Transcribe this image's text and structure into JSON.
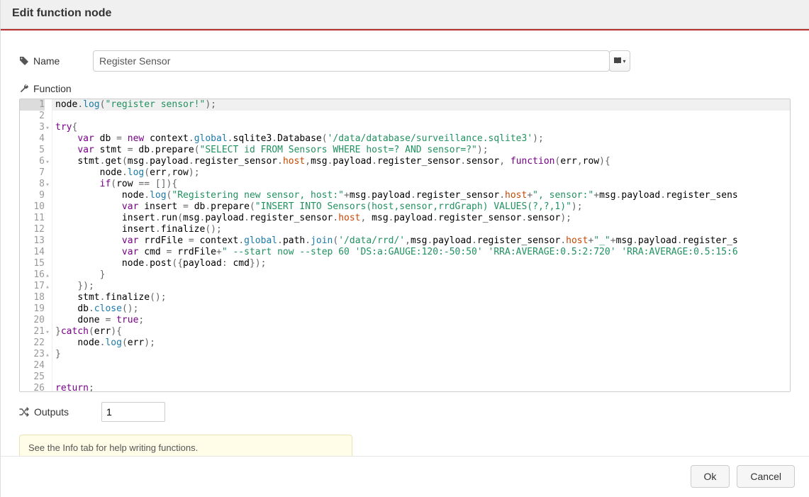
{
  "dialog": {
    "title": "Edit function node",
    "name_label": "Name",
    "name_value": "Register Sensor",
    "function_label": "Function",
    "outputs_label": "Outputs",
    "outputs_value": "1",
    "tip": "See the Info tab for help writing functions.",
    "ok_label": "Ok",
    "cancel_label": "Cancel",
    "book_icon": "book-icon",
    "dropdown_icon": "chevron-down-icon"
  },
  "editor": {
    "gutter": [
      {
        "n": "1",
        "fold": ""
      },
      {
        "n": "2",
        "fold": ""
      },
      {
        "n": "3",
        "fold": "▾"
      },
      {
        "n": "4",
        "fold": ""
      },
      {
        "n": "5",
        "fold": ""
      },
      {
        "n": "6",
        "fold": "▾"
      },
      {
        "n": "7",
        "fold": ""
      },
      {
        "n": "8",
        "fold": "▾"
      },
      {
        "n": "9",
        "fold": ""
      },
      {
        "n": "10",
        "fold": ""
      },
      {
        "n": "11",
        "fold": ""
      },
      {
        "n": "12",
        "fold": ""
      },
      {
        "n": "13",
        "fold": ""
      },
      {
        "n": "14",
        "fold": ""
      },
      {
        "n": "15",
        "fold": ""
      },
      {
        "n": "16",
        "fold": "▴"
      },
      {
        "n": "17",
        "fold": "▴"
      },
      {
        "n": "18",
        "fold": ""
      },
      {
        "n": "19",
        "fold": ""
      },
      {
        "n": "20",
        "fold": ""
      },
      {
        "n": "21",
        "fold": "▾"
      },
      {
        "n": "22",
        "fold": ""
      },
      {
        "n": "23",
        "fold": "▴"
      },
      {
        "n": "24",
        "fold": ""
      },
      {
        "n": "25",
        "fold": ""
      },
      {
        "n": "26",
        "fold": ""
      }
    ],
    "lines": [
      [
        {
          "c": "id",
          "t": "node"
        },
        {
          "c": "op",
          "t": "."
        },
        {
          "c": "glob",
          "t": "log"
        },
        {
          "c": "op",
          "t": "("
        },
        {
          "c": "str",
          "t": "\"register sensor!\""
        },
        {
          "c": "op",
          "t": ");"
        }
      ],
      [],
      [
        {
          "c": "kw",
          "t": "try"
        },
        {
          "c": "op",
          "t": "{"
        }
      ],
      [
        {
          "c": "ws",
          "t": "    "
        },
        {
          "c": "kw",
          "t": "var"
        },
        {
          "c": "ws",
          "t": " "
        },
        {
          "c": "id",
          "t": "db"
        },
        {
          "c": "ws",
          "t": " "
        },
        {
          "c": "op",
          "t": "="
        },
        {
          "c": "ws",
          "t": " "
        },
        {
          "c": "kw",
          "t": "new"
        },
        {
          "c": "ws",
          "t": " "
        },
        {
          "c": "id",
          "t": "context"
        },
        {
          "c": "op",
          "t": "."
        },
        {
          "c": "glob",
          "t": "global"
        },
        {
          "c": "op",
          "t": "."
        },
        {
          "c": "id",
          "t": "sqlite3"
        },
        {
          "c": "op",
          "t": "."
        },
        {
          "c": "id",
          "t": "Database"
        },
        {
          "c": "op",
          "t": "("
        },
        {
          "c": "str",
          "t": "'/data/database/surveillance.sqlite3'"
        },
        {
          "c": "op",
          "t": ");"
        }
      ],
      [
        {
          "c": "ws",
          "t": "    "
        },
        {
          "c": "kw",
          "t": "var"
        },
        {
          "c": "ws",
          "t": " "
        },
        {
          "c": "id",
          "t": "stmt"
        },
        {
          "c": "ws",
          "t": " "
        },
        {
          "c": "op",
          "t": "="
        },
        {
          "c": "ws",
          "t": " "
        },
        {
          "c": "id",
          "t": "db"
        },
        {
          "c": "op",
          "t": "."
        },
        {
          "c": "id",
          "t": "prepare"
        },
        {
          "c": "op",
          "t": "("
        },
        {
          "c": "str",
          "t": "\"SELECT id FROM Sensors WHERE host=? AND sensor=?\""
        },
        {
          "c": "op",
          "t": ");"
        }
      ],
      [
        {
          "c": "ws",
          "t": "    "
        },
        {
          "c": "id",
          "t": "stmt"
        },
        {
          "c": "op",
          "t": "."
        },
        {
          "c": "id",
          "t": "get"
        },
        {
          "c": "op",
          "t": "("
        },
        {
          "c": "id",
          "t": "msg"
        },
        {
          "c": "op",
          "t": "."
        },
        {
          "c": "id",
          "t": "payload"
        },
        {
          "c": "op",
          "t": "."
        },
        {
          "c": "id",
          "t": "register_sensor"
        },
        {
          "c": "op",
          "t": "."
        },
        {
          "c": "prop",
          "t": "host"
        },
        {
          "c": "op",
          "t": ","
        },
        {
          "c": "id",
          "t": "msg"
        },
        {
          "c": "op",
          "t": "."
        },
        {
          "c": "id",
          "t": "payload"
        },
        {
          "c": "op",
          "t": "."
        },
        {
          "c": "id",
          "t": "register_sensor"
        },
        {
          "c": "op",
          "t": "."
        },
        {
          "c": "id",
          "t": "sensor"
        },
        {
          "c": "op",
          "t": ", "
        },
        {
          "c": "kw",
          "t": "function"
        },
        {
          "c": "op",
          "t": "("
        },
        {
          "c": "id",
          "t": "err"
        },
        {
          "c": "op",
          "t": ","
        },
        {
          "c": "id",
          "t": "row"
        },
        {
          "c": "op",
          "t": "){"
        }
      ],
      [
        {
          "c": "ws",
          "t": "        "
        },
        {
          "c": "id",
          "t": "node"
        },
        {
          "c": "op",
          "t": "."
        },
        {
          "c": "glob",
          "t": "log"
        },
        {
          "c": "op",
          "t": "("
        },
        {
          "c": "id",
          "t": "err"
        },
        {
          "c": "op",
          "t": ","
        },
        {
          "c": "id",
          "t": "row"
        },
        {
          "c": "op",
          "t": ");"
        }
      ],
      [
        {
          "c": "ws",
          "t": "        "
        },
        {
          "c": "kw",
          "t": "if"
        },
        {
          "c": "op",
          "t": "("
        },
        {
          "c": "id",
          "t": "row"
        },
        {
          "c": "ws",
          "t": " "
        },
        {
          "c": "op",
          "t": "=="
        },
        {
          "c": "ws",
          "t": " "
        },
        {
          "c": "op",
          "t": "[]){"
        }
      ],
      [
        {
          "c": "ws",
          "t": "            "
        },
        {
          "c": "id",
          "t": "node"
        },
        {
          "c": "op",
          "t": "."
        },
        {
          "c": "glob",
          "t": "log"
        },
        {
          "c": "op",
          "t": "("
        },
        {
          "c": "str",
          "t": "\"Registering new sensor, host:\""
        },
        {
          "c": "op",
          "t": "+"
        },
        {
          "c": "id",
          "t": "msg"
        },
        {
          "c": "op",
          "t": "."
        },
        {
          "c": "id",
          "t": "payload"
        },
        {
          "c": "op",
          "t": "."
        },
        {
          "c": "id",
          "t": "register_sensor"
        },
        {
          "c": "op",
          "t": "."
        },
        {
          "c": "prop",
          "t": "host"
        },
        {
          "c": "op",
          "t": "+"
        },
        {
          "c": "str",
          "t": "\", sensor:\""
        },
        {
          "c": "op",
          "t": "+"
        },
        {
          "c": "id",
          "t": "msg"
        },
        {
          "c": "op",
          "t": "."
        },
        {
          "c": "id",
          "t": "payload"
        },
        {
          "c": "op",
          "t": "."
        },
        {
          "c": "id",
          "t": "register_sens"
        }
      ],
      [
        {
          "c": "ws",
          "t": "            "
        },
        {
          "c": "kw",
          "t": "var"
        },
        {
          "c": "ws",
          "t": " "
        },
        {
          "c": "id",
          "t": "insert"
        },
        {
          "c": "ws",
          "t": " "
        },
        {
          "c": "op",
          "t": "="
        },
        {
          "c": "ws",
          "t": " "
        },
        {
          "c": "id",
          "t": "db"
        },
        {
          "c": "op",
          "t": "."
        },
        {
          "c": "id",
          "t": "prepare"
        },
        {
          "c": "op",
          "t": "("
        },
        {
          "c": "str",
          "t": "\"INSERT INTO Sensors(host,sensor,rrdGraph) VALUES(?,?,1)\""
        },
        {
          "c": "op",
          "t": ");"
        }
      ],
      [
        {
          "c": "ws",
          "t": "            "
        },
        {
          "c": "id",
          "t": "insert"
        },
        {
          "c": "op",
          "t": "."
        },
        {
          "c": "id",
          "t": "run"
        },
        {
          "c": "op",
          "t": "("
        },
        {
          "c": "id",
          "t": "msg"
        },
        {
          "c": "op",
          "t": "."
        },
        {
          "c": "id",
          "t": "payload"
        },
        {
          "c": "op",
          "t": "."
        },
        {
          "c": "id",
          "t": "register_sensor"
        },
        {
          "c": "op",
          "t": "."
        },
        {
          "c": "prop",
          "t": "host"
        },
        {
          "c": "op",
          "t": ", "
        },
        {
          "c": "id",
          "t": "msg"
        },
        {
          "c": "op",
          "t": "."
        },
        {
          "c": "id",
          "t": "payload"
        },
        {
          "c": "op",
          "t": "."
        },
        {
          "c": "id",
          "t": "register_sensor"
        },
        {
          "c": "op",
          "t": "."
        },
        {
          "c": "id",
          "t": "sensor"
        },
        {
          "c": "op",
          "t": ");"
        }
      ],
      [
        {
          "c": "ws",
          "t": "            "
        },
        {
          "c": "id",
          "t": "insert"
        },
        {
          "c": "op",
          "t": "."
        },
        {
          "c": "id",
          "t": "finalize"
        },
        {
          "c": "op",
          "t": "();"
        }
      ],
      [
        {
          "c": "ws",
          "t": "            "
        },
        {
          "c": "kw",
          "t": "var"
        },
        {
          "c": "ws",
          "t": " "
        },
        {
          "c": "id",
          "t": "rrdFile"
        },
        {
          "c": "ws",
          "t": " "
        },
        {
          "c": "op",
          "t": "="
        },
        {
          "c": "ws",
          "t": " "
        },
        {
          "c": "id",
          "t": "context"
        },
        {
          "c": "op",
          "t": "."
        },
        {
          "c": "glob",
          "t": "global"
        },
        {
          "c": "op",
          "t": "."
        },
        {
          "c": "id",
          "t": "path"
        },
        {
          "c": "op",
          "t": "."
        },
        {
          "c": "glob",
          "t": "join"
        },
        {
          "c": "op",
          "t": "("
        },
        {
          "c": "str",
          "t": "'/data/rrd/'"
        },
        {
          "c": "op",
          "t": ","
        },
        {
          "c": "id",
          "t": "msg"
        },
        {
          "c": "op",
          "t": "."
        },
        {
          "c": "id",
          "t": "payload"
        },
        {
          "c": "op",
          "t": "."
        },
        {
          "c": "id",
          "t": "register_sensor"
        },
        {
          "c": "op",
          "t": "."
        },
        {
          "c": "prop",
          "t": "host"
        },
        {
          "c": "op",
          "t": "+"
        },
        {
          "c": "str",
          "t": "\"_\""
        },
        {
          "c": "op",
          "t": "+"
        },
        {
          "c": "id",
          "t": "msg"
        },
        {
          "c": "op",
          "t": "."
        },
        {
          "c": "id",
          "t": "payload"
        },
        {
          "c": "op",
          "t": "."
        },
        {
          "c": "id",
          "t": "register_s"
        }
      ],
      [
        {
          "c": "ws",
          "t": "            "
        },
        {
          "c": "kw",
          "t": "var"
        },
        {
          "c": "ws",
          "t": " "
        },
        {
          "c": "id",
          "t": "cmd"
        },
        {
          "c": "ws",
          "t": " "
        },
        {
          "c": "op",
          "t": "="
        },
        {
          "c": "ws",
          "t": " "
        },
        {
          "c": "id",
          "t": "rrdFile"
        },
        {
          "c": "op",
          "t": "+"
        },
        {
          "c": "str",
          "t": "\" --start now --step 60 'DS:a:GAUGE:120:-50:50' 'RRA:AVERAGE:0.5:2:720' 'RRA:AVERAGE:0.5:15:6"
        }
      ],
      [
        {
          "c": "ws",
          "t": "            "
        },
        {
          "c": "id",
          "t": "node"
        },
        {
          "c": "op",
          "t": "."
        },
        {
          "c": "id",
          "t": "post"
        },
        {
          "c": "op",
          "t": "({"
        },
        {
          "c": "id",
          "t": "payload"
        },
        {
          "c": "op",
          "t": ": "
        },
        {
          "c": "id",
          "t": "cmd"
        },
        {
          "c": "op",
          "t": "});"
        }
      ],
      [
        {
          "c": "ws",
          "t": "        "
        },
        {
          "c": "op",
          "t": "}"
        }
      ],
      [
        {
          "c": "ws",
          "t": "    "
        },
        {
          "c": "op",
          "t": "});"
        }
      ],
      [
        {
          "c": "ws",
          "t": "    "
        },
        {
          "c": "id",
          "t": "stmt"
        },
        {
          "c": "op",
          "t": "."
        },
        {
          "c": "id",
          "t": "finalize"
        },
        {
          "c": "op",
          "t": "();"
        }
      ],
      [
        {
          "c": "ws",
          "t": "    "
        },
        {
          "c": "id",
          "t": "db"
        },
        {
          "c": "op",
          "t": "."
        },
        {
          "c": "glob",
          "t": "close"
        },
        {
          "c": "op",
          "t": "();"
        }
      ],
      [
        {
          "c": "ws",
          "t": "    "
        },
        {
          "c": "id",
          "t": "done"
        },
        {
          "c": "ws",
          "t": " "
        },
        {
          "c": "op",
          "t": "="
        },
        {
          "c": "ws",
          "t": " "
        },
        {
          "c": "kw",
          "t": "true"
        },
        {
          "c": "op",
          "t": ";"
        }
      ],
      [
        {
          "c": "op",
          "t": "}"
        },
        {
          "c": "kw",
          "t": "catch"
        },
        {
          "c": "op",
          "t": "("
        },
        {
          "c": "id",
          "t": "err"
        },
        {
          "c": "op",
          "t": "){"
        }
      ],
      [
        {
          "c": "ws",
          "t": "    "
        },
        {
          "c": "id",
          "t": "node"
        },
        {
          "c": "op",
          "t": "."
        },
        {
          "c": "glob",
          "t": "log"
        },
        {
          "c": "op",
          "t": "("
        },
        {
          "c": "id",
          "t": "err"
        },
        {
          "c": "op",
          "t": ");"
        }
      ],
      [
        {
          "c": "op",
          "t": "}"
        }
      ],
      [],
      [],
      [
        {
          "c": "kw",
          "t": "return"
        },
        {
          "c": "op",
          "t": ";"
        }
      ]
    ]
  }
}
